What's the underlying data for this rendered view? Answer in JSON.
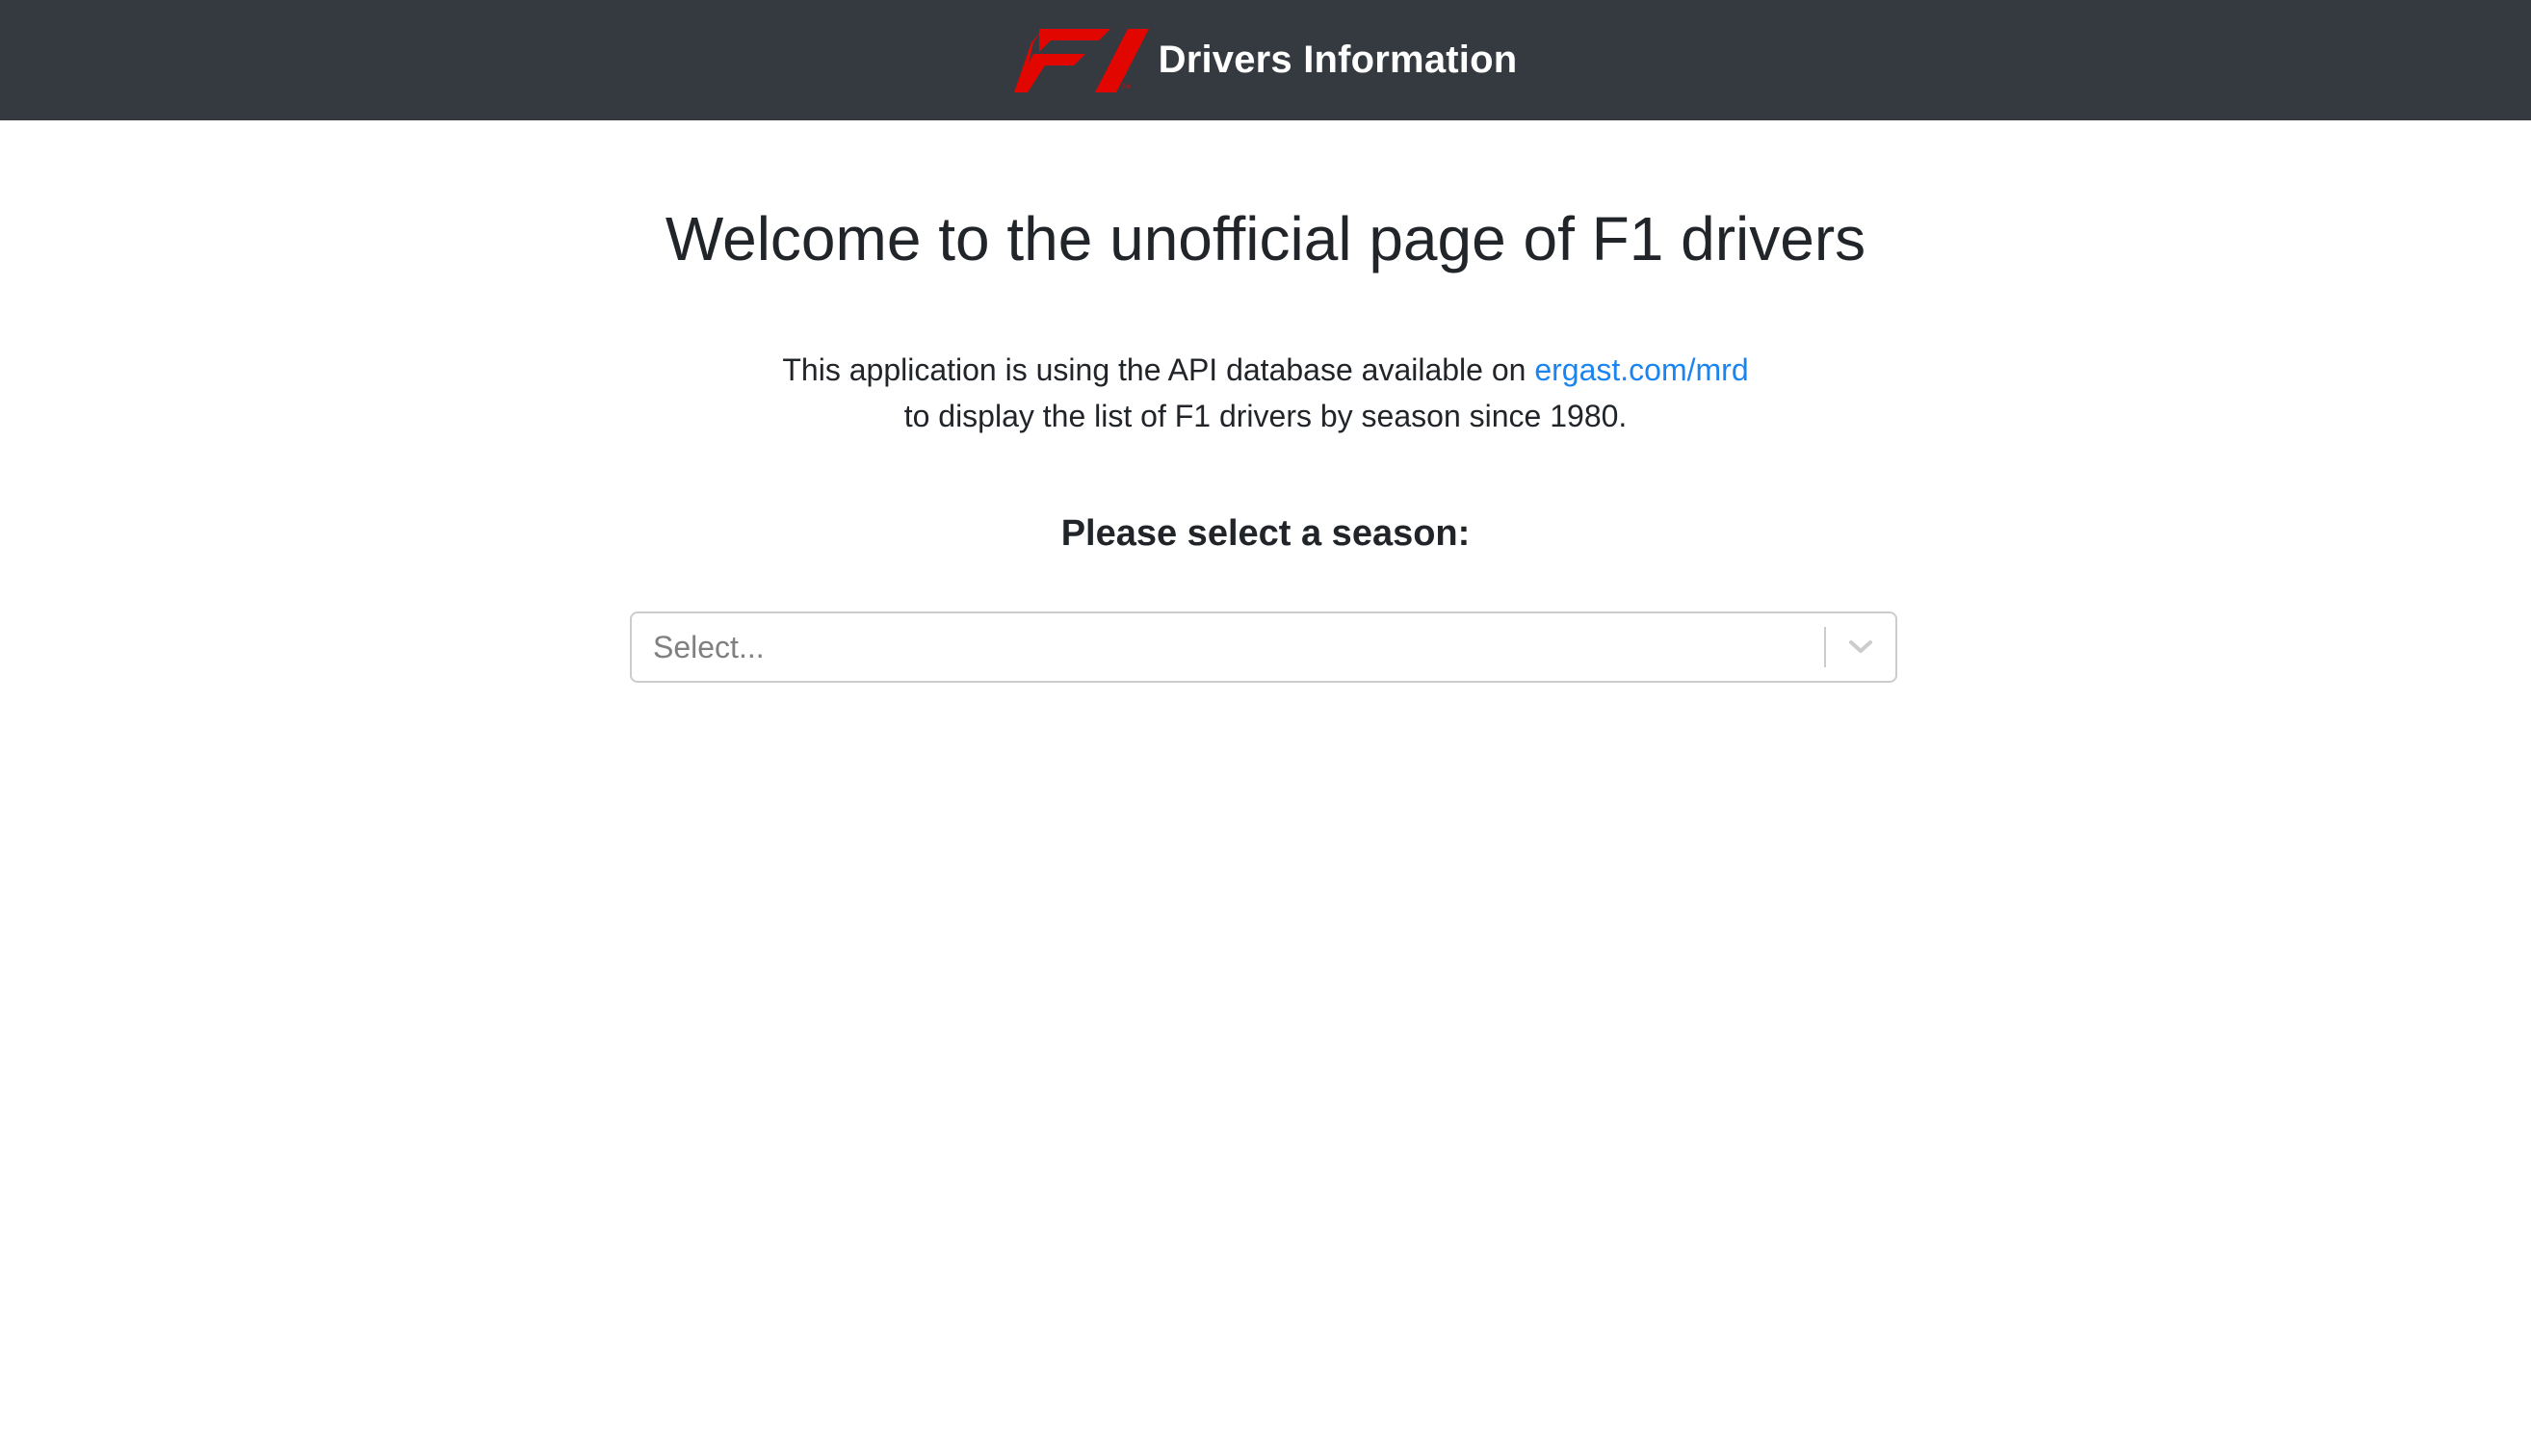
{
  "header": {
    "logo_icon": "f1-logo-icon",
    "title": "Drivers Information",
    "brand_color": "#343a40",
    "logo_color": "#e10600"
  },
  "main": {
    "title": "Welcome to the unofficial page of F1 drivers",
    "intro_text_1": "This application is using the API database available on",
    "api_link": "ergast.com/mrd",
    "intro_text_2": "to display the list of F1 drivers by season since 1980.",
    "season_label": "Please select a season:",
    "season_select": {
      "placeholder": "Select...",
      "indicator_icon": "chevron-down-icon"
    },
    "link_color": "#1a84f0"
  }
}
